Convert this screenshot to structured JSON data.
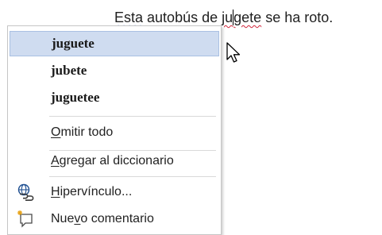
{
  "document": {
    "segments": [
      {
        "text": "Esta",
        "squiggle": "blue"
      },
      {
        "text": " autobús de ",
        "squiggle": ""
      },
      {
        "text": "ju",
        "squiggle": "red"
      },
      {
        "text": "gete",
        "squiggle": "red"
      },
      {
        "text": " se ha roto.",
        "squiggle": ""
      }
    ]
  },
  "context_menu": {
    "suggestions": [
      {
        "label": "juguete",
        "highlighted": true
      },
      {
        "label": "jubete",
        "highlighted": false
      },
      {
        "label": "juguetee",
        "highlighted": false
      }
    ],
    "ignore_all": {
      "mnemonic": "O",
      "rest": "mitir todo"
    },
    "add_to_dictionary": {
      "mnemonic": "A",
      "rest": "gregar al diccionario"
    },
    "hyperlink": {
      "mnemonic": "H",
      "rest": "ipervínculo...",
      "icon": "hyperlink-globe-icon"
    },
    "new_comment": {
      "prefix": "Nue",
      "mnemonic": "v",
      "rest": "o comentario",
      "icon": "new-comment-icon"
    }
  },
  "colors": {
    "highlight_bg": "#cfdcf0",
    "highlight_border": "#a9c0e3",
    "squiggle_blue": "#2a55d6",
    "squiggle_red": "#d0243a"
  }
}
